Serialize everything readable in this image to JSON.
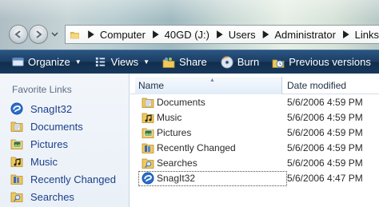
{
  "address": {
    "crumbs": [
      "Computer",
      "40GD (J:)",
      "Users",
      "Administrator",
      "Links"
    ]
  },
  "toolbar": {
    "organize": "Organize",
    "views": "Views",
    "share": "Share",
    "burn": "Burn",
    "previous_versions": "Previous versions"
  },
  "sidebar": {
    "title": "Favorite Links",
    "items": [
      {
        "label": "SnagIt32",
        "icon": "snagit-icon"
      },
      {
        "label": "Documents",
        "icon": "documents-folder-icon"
      },
      {
        "label": "Pictures",
        "icon": "pictures-folder-icon"
      },
      {
        "label": "Music",
        "icon": "music-folder-icon"
      },
      {
        "label": "Recently Changed",
        "icon": "recently-changed-icon"
      },
      {
        "label": "Searches",
        "icon": "searches-folder-icon"
      }
    ]
  },
  "filelist": {
    "columns": {
      "name": "Name",
      "date": "Date modified"
    },
    "rows": [
      {
        "name": "Documents",
        "date": "5/6/2006 4:59 PM"
      },
      {
        "name": "Music",
        "date": "5/6/2006 4:59 PM"
      },
      {
        "name": "Pictures",
        "date": "5/6/2006 4:59 PM"
      },
      {
        "name": "Recently Changed",
        "date": "5/6/2006 4:59 PM"
      },
      {
        "name": "Searches",
        "date": "5/6/2006 4:59 PM"
      },
      {
        "name": "SnagIt32",
        "date": "5/6/2006 4:47 PM"
      }
    ]
  },
  "colors": {
    "toolbar": "#1c3d63",
    "link_text": "#1b3f8c",
    "pane_bg": "#eef3f9"
  }
}
